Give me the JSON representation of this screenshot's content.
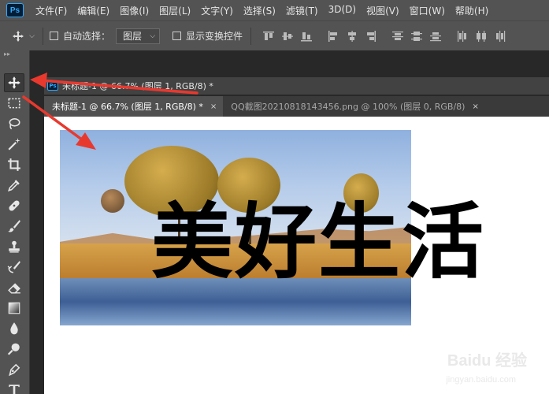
{
  "app": {
    "logo_text": "Ps"
  },
  "menu": {
    "items": [
      "文件(F)",
      "编辑(E)",
      "图像(I)",
      "图层(L)",
      "文字(Y)",
      "选择(S)",
      "滤镜(T)",
      "3D(D)",
      "视图(V)",
      "窗口(W)",
      "帮助(H)"
    ]
  },
  "options": {
    "auto_select_label": "自动选择：",
    "auto_select_value": "图层",
    "show_transform_label": "显示变换控件"
  },
  "toolbar": {
    "tools": [
      "move-tool",
      "marquee-tool",
      "lasso-tool",
      "magic-wand-tool",
      "crop-tool",
      "eyedropper-tool",
      "healing-brush-tool",
      "brush-tool",
      "clone-stamp-tool",
      "history-brush-tool",
      "eraser-tool",
      "gradient-tool",
      "blur-tool",
      "dodge-tool",
      "pen-tool",
      "type-tool"
    ],
    "active": "move-tool"
  },
  "document": {
    "floating_title": "未标题-1 @ 66.7% (图层 1, RGB/8) *",
    "tabs": [
      {
        "label": "未标题-1 @ 66.7% (图层 1, RGB/8) *",
        "active": true
      },
      {
        "label": "QQ截图20210818143456.png @ 100% (图层 0, RGB/8)",
        "active": false
      }
    ],
    "tab_close_glyph": "×"
  },
  "canvas": {
    "text": "美好生活"
  },
  "watermark": {
    "main": "Baidu 经验",
    "sub": "jingyan.baidu.com"
  },
  "colors": {
    "annotation_arrow": "#e8392f",
    "ps_blue": "#31a8ff"
  }
}
